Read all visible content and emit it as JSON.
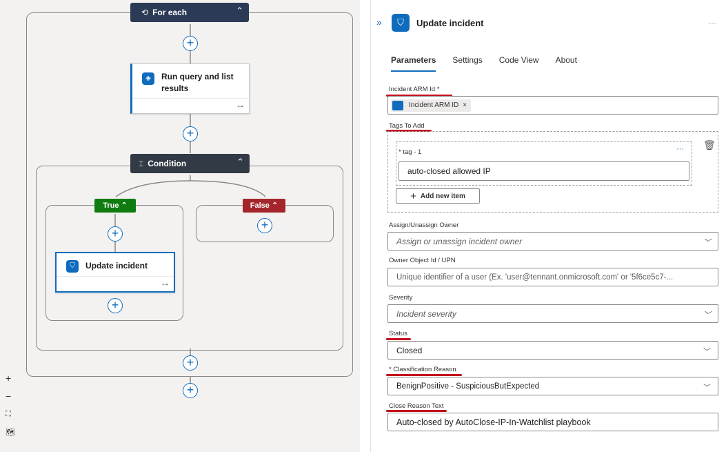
{
  "canvas": {
    "for_each": "For each",
    "run_query": "Run query and list results",
    "condition": "Condition",
    "true_label": "True",
    "false_label": "False",
    "update_incident": "Update incident",
    "zoom_in": "+",
    "zoom_out": "−",
    "fit": "⛶",
    "map": "🗺"
  },
  "panel": {
    "title": "Update incident",
    "more": "···",
    "expand": "»",
    "tabs": [
      "Parameters",
      "Settings",
      "Code View",
      "About"
    ],
    "incident_arm_id": {
      "label": "Incident ARM Id *",
      "token": "Incident ARM ID",
      "token_close": "×"
    },
    "tags_to_add": {
      "label": "Tags To Add",
      "item_label": "* tag - 1",
      "item_value": "auto-closed allowed IP",
      "item_more": "···",
      "add_button": "Add new item"
    },
    "assign_owner": {
      "label": "Assign/Unassign Owner",
      "placeholder": "Assign or unassign incident owner"
    },
    "owner_object_id": {
      "label": "Owner Object Id / UPN",
      "placeholder": "Unique identifier of a user (Ex. 'user@tennant.onmicrosoft.com' or '5f6ce5c7-..."
    },
    "severity": {
      "label": "Severity",
      "placeholder": "Incident severity"
    },
    "status": {
      "label": "Status",
      "value": "Closed"
    },
    "classification_reason": {
      "label": "* Classification Reason",
      "value": "BenignPositive - SuspiciousButExpected"
    },
    "close_reason_text": {
      "label": "Close Reason Text",
      "value": "Auto-closed by AutoClose-IP-In-Watchlist playbook"
    }
  },
  "colors": {
    "accent": "#0f6cbd",
    "header_dark": "#2b3a55",
    "condition_dark": "#323a45",
    "true_green": "#107c10",
    "false_red": "#a4262c",
    "annotation_red": "#c50f1f"
  }
}
